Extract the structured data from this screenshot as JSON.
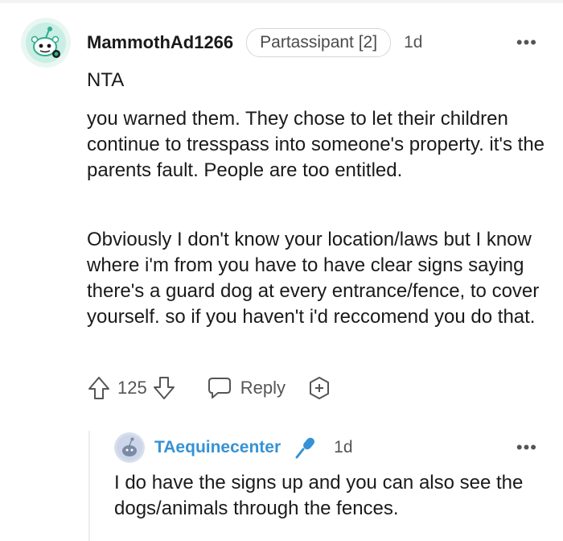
{
  "comment": {
    "author": "MammothAd1266",
    "flair": "Partassipant [2]",
    "time": "1d",
    "more": "•••",
    "verdict": "NTA",
    "paragraph_1": "you warned them. They chose to let their children continue to tresspass into someone's property. it's the parents fault. People are too entitled.",
    "paragraph_2": "Obviously I don't know your location/laws but I know where i'm from you have to have clear signs saying there's a guard dog at every entrance/fence, to cover yourself. so if you haven't i'd reccomend you do that.",
    "votes": "125",
    "reply_label": "Reply",
    "icons": {
      "avatar": "snoo-avatar-icon",
      "upvote": "arrow-up-icon",
      "downvote": "arrow-down-icon",
      "reply": "speech-bubble-icon",
      "award": "award-plus-icon"
    }
  },
  "reply": {
    "author": "TAequinecenter",
    "time": "1d",
    "more": "•••",
    "text": "I do have the signs up and you can also see the dogs/animals through the fences.",
    "icons": {
      "avatar": "snoo-avatar-icon",
      "badge": "microphone-icon"
    }
  },
  "colors": {
    "reply_author": "#3592d5",
    "text": "#1a1a1b",
    "muted": "#555555",
    "avatar_accent": "#2fae8f"
  }
}
